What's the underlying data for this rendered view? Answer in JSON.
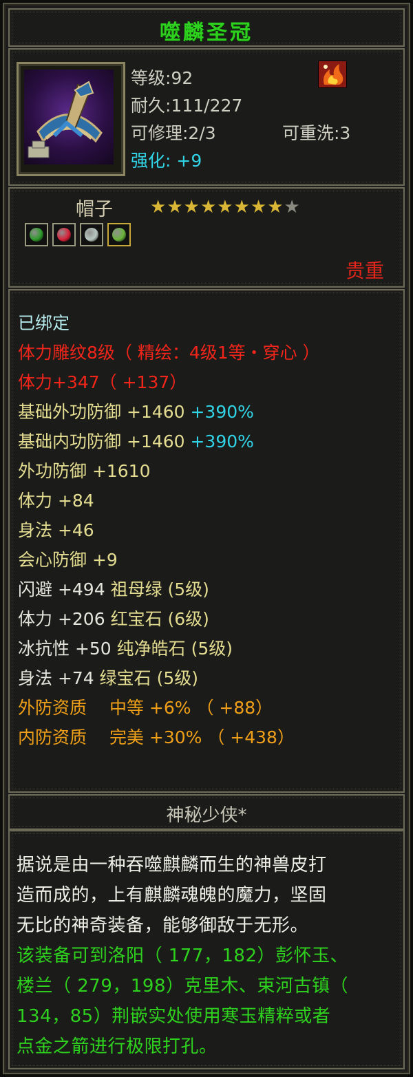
{
  "item": {
    "name": "噬麟圣冠",
    "level": "等级:92",
    "durability": "耐久:111/227",
    "repairable": "可修理:2/3",
    "rewash": "可重洗:3",
    "enhance": "强化: +9",
    "type": "帽子",
    "stars_filled": 8,
    "stars_total": 9,
    "rarity": "贵重",
    "gem_colors": [
      "#2e9a2a",
      "#d8223a",
      "#b8c8c0",
      "#6ab23a"
    ]
  },
  "attributes": {
    "bound": "已绑定",
    "engrave": "体力雕纹8级（ 精绘：4级1等・穿心 ）",
    "stamina_bonus": "体力+347（ +137）",
    "base_ext_def": "基础外功防御 +1460",
    "base_ext_def_pct": "+390%",
    "base_int_def": "基础内功防御 +1460",
    "base_int_def_pct": "+390%",
    "ext_def": "外功防御 +1610",
    "stamina": "体力 +84",
    "agility": "身法 +46",
    "crit_def": "会心防御 +9",
    "dodge": "闪避 +494",
    "dodge_gem": "祖母绿 (5级)",
    "stamina_gem_line": "体力 +206",
    "stamina_gem": "红宝石 (6级)",
    "ice_res": "冰抗性 +50",
    "ice_gem": "纯净皓石 (5级)",
    "agility_gem_line": "身法 +74",
    "agility_gem": "绿宝石 (5级)",
    "ext_quality": "外防资质　 中等 +6% （ +88）",
    "int_quality": "内防资质　 完美 +30% （ +438）"
  },
  "author": "神秘少侠*",
  "description": {
    "line1": "据说是由一种吞噬麒麟而生的神兽皮打",
    "line2": "造而成的，上有麒麟魂魄的魔力，坚固",
    "line3": "无比的神奇装备，能够御敌于无形。",
    "line4": "该装备可到洛阳（ 177，182）彭怀玉、",
    "line5": "楼兰（ 279，198）克里木、束河古镇（",
    "line6": "134，85）荆嵌实处使用寒玉精粹或者",
    "line7": "点金之箭进行极限打孔。"
  }
}
